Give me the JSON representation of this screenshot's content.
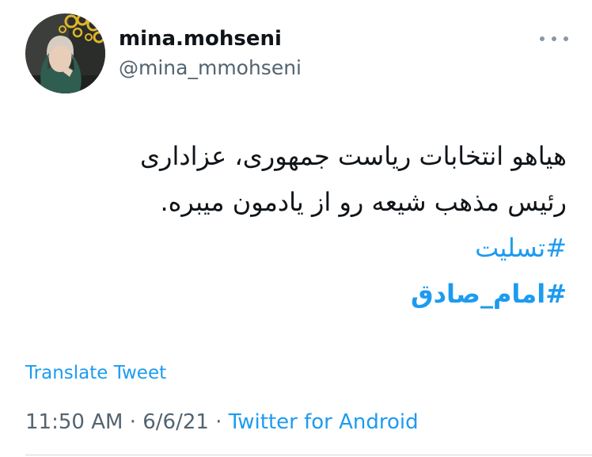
{
  "author": {
    "display_name": "mina.mohseni",
    "handle": "@mina_mmohseni"
  },
  "more_icon": "more-horizontal-icon",
  "tweet": {
    "lines": [
      "هیاهو انتخابات ریاست جمهوری، عزاداری",
      "رئیس مذهب شیعه رو از یادمون میبره."
    ],
    "hashtags": [
      "#تسلیت",
      "#امام_صادق"
    ]
  },
  "translate_label": "Translate Tweet",
  "meta": {
    "time": "11:50 AM",
    "separator": "·",
    "date": "6/6/21",
    "source": "Twitter for Android"
  },
  "colors": {
    "link": "#1d9bf0",
    "secondary_text": "#536471",
    "primary_text": "#0f1419"
  }
}
